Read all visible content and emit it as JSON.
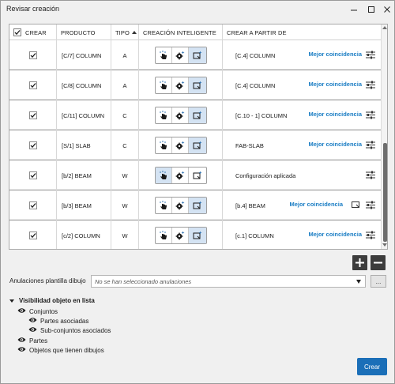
{
  "window": {
    "title": "Revisar creación"
  },
  "grid": {
    "headers": {
      "crear": "CREAR",
      "producto": "PRODUCTO",
      "tipo": "TIPO",
      "creacion": "CREACIÓN INTELIGENTE",
      "crear_a_partir": "CREAR A PARTIR DE"
    },
    "header_checked": true,
    "sorted_column": "tipo",
    "sort_direction": "ascending",
    "rows": [
      {
        "checked": true,
        "producto": "[C/7] COLUMN",
        "tipo": "A",
        "active_mode": "third",
        "source": "[C.4] COLUMN",
        "match": "Mejor coincidencia",
        "has_doc_icon": false
      },
      {
        "checked": true,
        "producto": "[C/8] COLUMN",
        "tipo": "A",
        "active_mode": "third",
        "source": "[C.4] COLUMN",
        "match": "Mejor coincidencia",
        "has_doc_icon": false
      },
      {
        "checked": true,
        "producto": "[C/11] COLUMN",
        "tipo": "C",
        "active_mode": "third",
        "source": "[C.10 - 1] COLUMN",
        "match": "Mejor coincidencia",
        "has_doc_icon": false
      },
      {
        "checked": true,
        "producto": "[S/1] SLAB",
        "tipo": "C",
        "active_mode": "third",
        "source": "FAB-SLAB",
        "match": "Mejor coincidencia",
        "has_doc_icon": false
      },
      {
        "checked": true,
        "producto": "[b/2] BEAM",
        "tipo": "W",
        "active_mode": "first",
        "source": "Configuración aplicada",
        "match": "",
        "has_doc_icon": false
      },
      {
        "checked": true,
        "producto": "[b/3] BEAM",
        "tipo": "W",
        "active_mode": "third",
        "source": "[b.4] BEAM",
        "match": "Mejor coincidencia",
        "has_doc_icon": true
      },
      {
        "checked": true,
        "producto": "[c/2] COLUMN",
        "tipo": "W",
        "active_mode": "third",
        "source": "[c.1] COLUMN",
        "match": "Mejor coincidencia",
        "has_doc_icon": false
      }
    ]
  },
  "icons": {
    "mode_1": "hand-touch-icon",
    "mode_2": "gear-sparkle-icon",
    "mode_3": "document-sparkle-icon",
    "settings": "sliders-icon",
    "add": "plus-icon",
    "remove": "minus-icon",
    "eye": "eye-icon"
  },
  "anulaciones": {
    "label": "Anulaciones plantilla dibujo",
    "placeholder": "No se han seleccionado anulaciones",
    "browse": "..."
  },
  "visibilidad": {
    "title": "Visibilidad objeto en lista",
    "items": [
      {
        "label": "Conjuntos",
        "level": 1
      },
      {
        "label": "Partes asociadas",
        "level": 2
      },
      {
        "label": "Sub-conjuntos asociados",
        "level": 2
      },
      {
        "label": "Partes",
        "level": 1
      },
      {
        "label": "Objetos que tienen dibujos",
        "level": 1
      }
    ]
  },
  "footer": {
    "create_label": "Crear"
  },
  "colors": {
    "accent": "#1a7dc4",
    "button": "#1b6fb8",
    "active_segment": "#d4e3f3"
  }
}
